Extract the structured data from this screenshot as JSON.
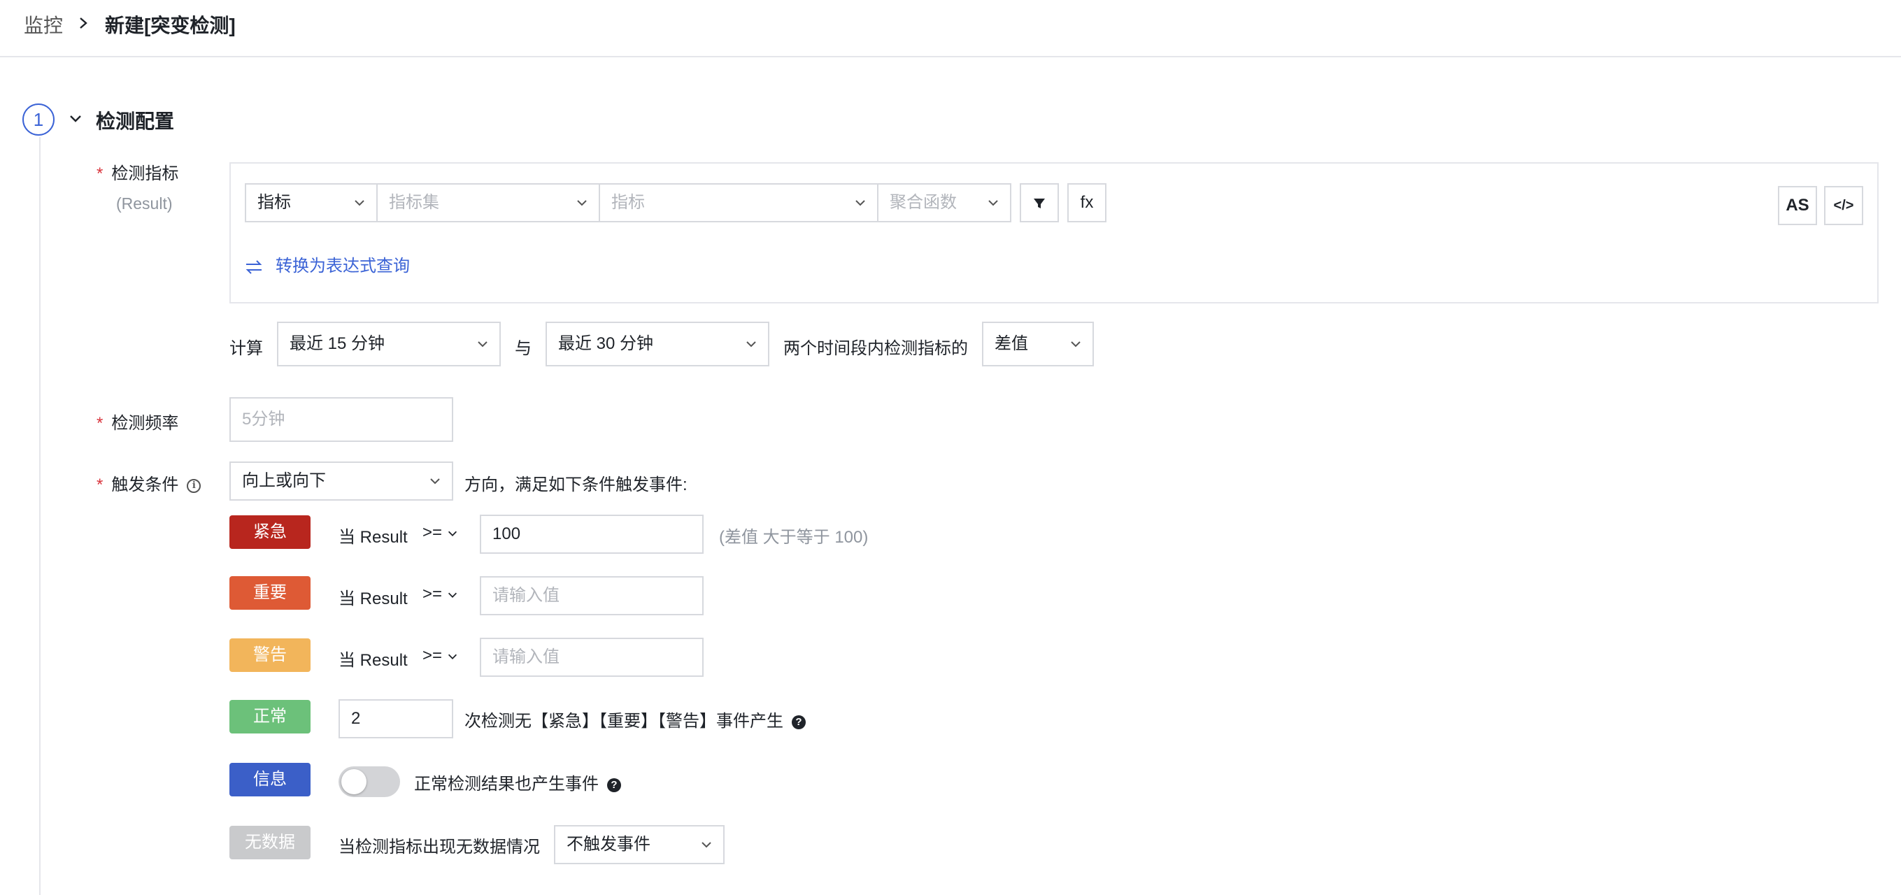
{
  "breadcrumb": {
    "root": "监控",
    "current": "新建[突变检测]"
  },
  "section": {
    "step_number": "1",
    "title": "检测配置"
  },
  "metric": {
    "label": "检测指标",
    "sublabel": "(Result)",
    "type_select": "指标",
    "metric_set_placeholder": "指标集",
    "metric_placeholder": "指标",
    "agg_placeholder": "聚合函数",
    "fx_label": "fx",
    "as_label": "AS",
    "code_icon": "</>",
    "convert_link": "转换为表达式查询"
  },
  "compute": {
    "label": "计算",
    "range1": "最近 15 分钟",
    "with": "与",
    "range2": "最近 30 分钟",
    "desc": "两个时间段内检测指标的",
    "mode": "差值"
  },
  "frequency": {
    "label": "检测频率",
    "placeholder": "5分钟"
  },
  "trigger": {
    "label": "触发条件",
    "direction": "向上或向下",
    "direction_desc": "方向，满足如下条件触发事件:"
  },
  "levels": {
    "critical": {
      "badge": "紧急",
      "color": "#b8261e",
      "prefix": "当 Result",
      "op": ">=",
      "value": "100",
      "hint": "(差值 大于等于 100)"
    },
    "major": {
      "badge": "重要",
      "color": "#de5a35",
      "prefix": "当 Result",
      "op": ">=",
      "placeholder": "请输入值"
    },
    "warning": {
      "badge": "警告",
      "color": "#f2b55b",
      "prefix": "当 Result",
      "op": ">=",
      "placeholder": "请输入值"
    },
    "normal": {
      "badge": "正常",
      "color": "#6cc17a",
      "value": "2",
      "desc": "次检测无【紧急】【重要】【警告】事件产生"
    },
    "info": {
      "badge": "信息",
      "color": "#3b5fc8",
      "desc": "正常检测结果也产生事件"
    },
    "nodata": {
      "badge": "无数据",
      "color": "#c9cacc",
      "desc": "当检测指标出现无数据情况",
      "select": "不触发事件"
    }
  }
}
